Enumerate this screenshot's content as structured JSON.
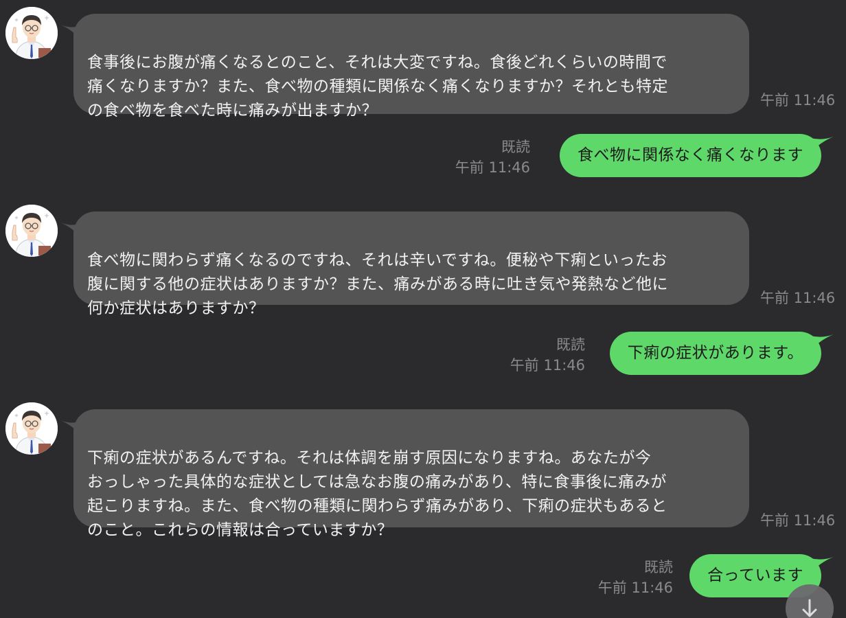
{
  "messages": [
    {
      "from": "doctor",
      "text": "食事後にお腹が痛くなるとのこと、それは大変ですね。食後どれくらいの時間で\n痛くなりますか？また、食べ物の種類に関係なく痛くなりますか？それとも特定\nの食べ物を食べた時に痛みが出ますか？",
      "time": "午前 11:46"
    },
    {
      "from": "user",
      "text": "食べ物に関係なく痛くなります",
      "read": "既読",
      "time": "午前 11:46"
    },
    {
      "from": "doctor",
      "text": "食べ物に関わらず痛くなるのですね、それは辛いですね。便秘や下痢といったお\n腹に関する他の症状はありますか？また、痛みがある時に吐き気や発熱など他に\n何か症状はありますか？",
      "time": "午前 11:46"
    },
    {
      "from": "user",
      "text": "下痢の症状があります。",
      "read": "既読",
      "time": "午前 11:46"
    },
    {
      "from": "doctor",
      "text": "下痢の症状があるんですね。それは体調を崩す原因になりますね。あなたが今\nおっしゃった具体的な症状としては急なお腹の痛みがあり、特に食事後に痛みが\n起こりますね。また、食べ物の種類に関わらず痛みがあり、下痢の症状もあると\nのこと。これらの情報は合っていますか？",
      "time": "午前 11:46"
    },
    {
      "from": "user",
      "text": "合っています",
      "read": "既読",
      "time": "午前 11:46"
    }
  ],
  "icons": {
    "avatar": "doctor-avatar-icon",
    "scroll": "arrow-down-icon"
  },
  "colors": {
    "background": "#2b2b2e",
    "incoming_bubble": "#545454",
    "outgoing_bubble": "#5fd86a",
    "meta_text": "#8a8a8a"
  }
}
